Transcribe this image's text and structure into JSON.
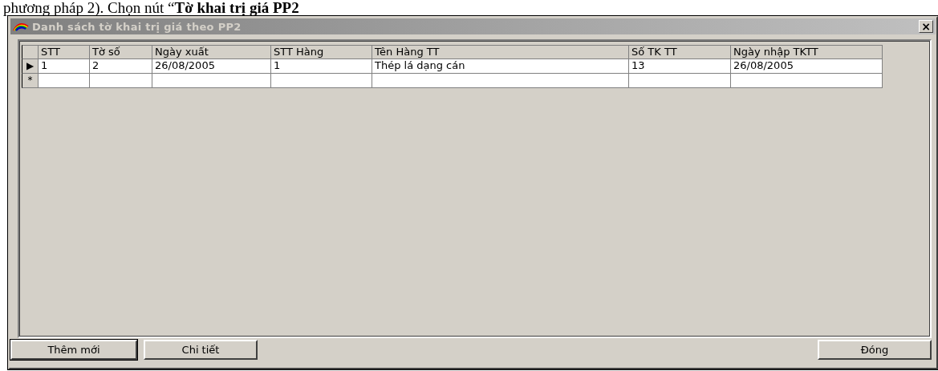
{
  "document_text": "phương pháp 2). Chọn nút “**Tờ khai trị giá PP2**",
  "window": {
    "title": "Danh sách tờ khai trị giá theo PP2",
    "close": "×"
  },
  "table": {
    "columns": [
      "STT",
      "Tờ số",
      "Ngày xuất",
      "STT Hàng",
      "Tên Hàng TT",
      "Số  TK TT",
      "Ngày nhập TKTT"
    ],
    "rows": [
      {
        "indicator": "▶",
        "cells": [
          "1",
          "2",
          "26/08/2005",
          "1",
          "Thép lá dạng cán",
          "13",
          "26/08/2005"
        ]
      },
      {
        "indicator": "*",
        "cells": [
          "",
          "",
          "",
          "",
          "",
          "",
          ""
        ]
      }
    ]
  },
  "buttons": [
    {
      "label": "Thêm mới",
      "focused": true
    },
    {
      "label": "Chi tiết",
      "focused": false
    },
    {
      "label": "Đóng",
      "focused": false
    }
  ]
}
